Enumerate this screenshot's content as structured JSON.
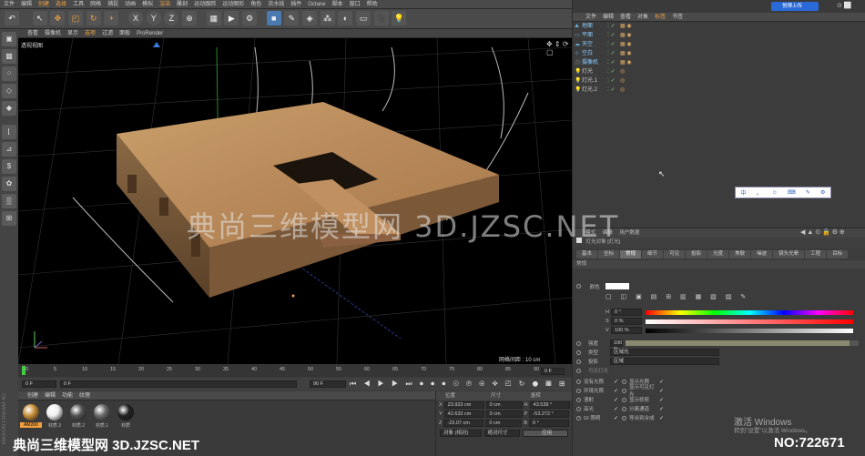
{
  "menu": [
    "文件",
    "编辑",
    "创建",
    "选择",
    "工具",
    "网格",
    "捕捉",
    "动画",
    "模拟",
    "渲染",
    "雕刻",
    "运动跟踪",
    "运动图形",
    "角色",
    "流水线",
    "插件",
    "Octane",
    "脚本",
    "窗口",
    "帮助"
  ],
  "toolbar_icons": [
    "undo-icon",
    "select-icon",
    "move-icon",
    "scale-icon",
    "rotate-icon",
    "move-axis-icon",
    "x-axis-icon",
    "y-axis-icon",
    "z-axis-icon",
    "coord-icon",
    "render-region-icon",
    "render-view-icon",
    "render-settings-icon",
    "cube-icon",
    "pen-icon",
    "subdivide-icon",
    "array-icon",
    "deformer-icon",
    "floor-icon",
    "camera-icon",
    "light-icon"
  ],
  "toolbar_axes": [
    "X",
    "Y",
    "Z"
  ],
  "viewport": {
    "menu": [
      "查看",
      "摄像机",
      "显示",
      "选项",
      "过滤",
      "面板",
      "ProRender"
    ],
    "label": "透视视图",
    "grid_label": "网格间距 : 10 cm"
  },
  "timeline": {
    "ticks": [
      "0",
      "5",
      "10",
      "15",
      "20",
      "25",
      "30",
      "35",
      "40",
      "45",
      "50",
      "55",
      "60",
      "65",
      "70",
      "75",
      "80",
      "85",
      "90"
    ],
    "end_frame": "0 F",
    "start_field": "0 F",
    "min_field": "0 F",
    "max_field": "90 F",
    "end_field": "90 F"
  },
  "material_panel": {
    "menu": [
      "创建",
      "编辑",
      "功能",
      "纹理"
    ],
    "materials": [
      {
        "name": "AM200",
        "color": "#c8903a"
      },
      {
        "name": "材质.3",
        "color": "#f0f0f0"
      },
      {
        "name": "材质.2",
        "color": "#555555"
      },
      {
        "name": "材质.1",
        "color": "#6a6a6a"
      },
      {
        "name": "材质",
        "color": "#222222"
      }
    ]
  },
  "coords": {
    "headers": [
      "位置",
      "尺寸",
      "旋转"
    ],
    "rows": [
      {
        "axis": "X",
        "pos": "23.923 cm",
        "size": "0 cm",
        "rot_axis": "H",
        "rot": "43.539 °"
      },
      {
        "axis": "Y",
        "pos": "42.633 cm",
        "size": "0 cm",
        "rot_axis": "P",
        "rot": "-53.272 °"
      },
      {
        "axis": "Z",
        "pos": "-23.07 cm",
        "size": "0 cm",
        "rot_axis": "B",
        "rot": "0 °"
      }
    ],
    "mode_select": "对象 (相对)",
    "size_select": "绝对尺寸",
    "apply_button": "应用"
  },
  "object_manager": {
    "menu": [
      "文件",
      "编辑",
      "查看",
      "对象",
      "标签",
      "书签"
    ],
    "objects": [
      "地面",
      "平面",
      "天空",
      "空白",
      "摄像机",
      "灯光",
      "灯光.1",
      "灯光.2"
    ]
  },
  "top_right": {
    "upload_button": "悦博上传"
  },
  "ime_bar": [
    "中",
    "。",
    "☺",
    "⌨",
    "✎",
    "⚙"
  ],
  "attributes": {
    "tabs_top": [
      "模式",
      "编辑",
      "用户数据"
    ],
    "title": "灯光对象 [灯光]",
    "tabs": [
      "基本",
      "坐标",
      "常规",
      "细节",
      "可见",
      "投影",
      "光度",
      "焦散",
      "噪波",
      "镜头光晕",
      "工程",
      "目标"
    ],
    "active_tab": "常规",
    "section": "常规",
    "color_label": "颜色",
    "h_label": "H",
    "h_value": "0 °",
    "s_label": "S",
    "s_value": "0 %",
    "v_label": "V",
    "v_value": "100 %",
    "intensity_label": "强度",
    "intensity_value": "100 %",
    "type_label": "类型",
    "type_value": "区域光",
    "shadow_label": "投影",
    "shadow_value": "区域",
    "visible_light_label": "可见灯光",
    "checks_left": [
      "没有光照",
      "环境光照",
      "漫射",
      "高光",
      "GI 照明"
    ],
    "checks_right": [
      "显示光照",
      "显示可见灯光",
      "显示修剪",
      "分离通道",
      "导出到合成"
    ]
  },
  "watermarks": {
    "center": "典尚三维模型网 3D.JZSC.NET",
    "bottom_left": "典尚三维模型网 3D.JZSC.NET",
    "bottom_right": "NO:722671",
    "activate_title": "激活 Windows",
    "activate_sub": "转到\"设置\"以激活 Windows。"
  },
  "brand": "MAXON CINEMA 4D",
  "colors": {
    "accent": "#f0a040",
    "selected_tab": "#6a6a6a",
    "viewport_bg": "#000000"
  }
}
